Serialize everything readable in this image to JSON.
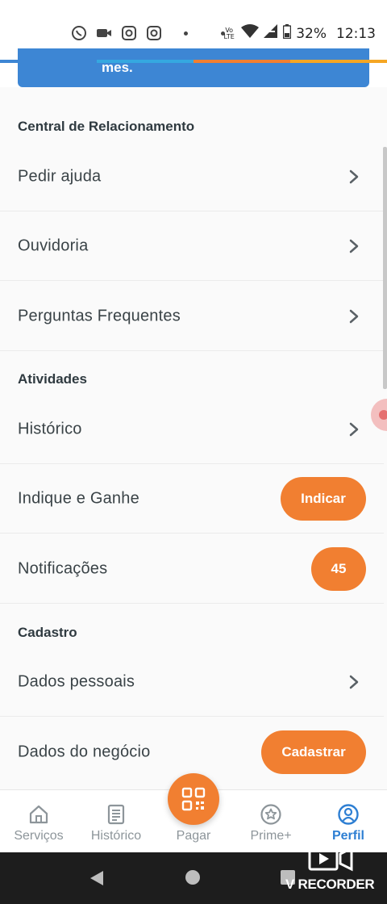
{
  "status_bar": {
    "battery": "32%",
    "time": "12:13",
    "volte_top": "Vo",
    "volte_bottom": "LTE"
  },
  "banner": {
    "text": "mes."
  },
  "sections": {
    "central": "Central de Relacionamento",
    "atividades": "Atividades",
    "cadastro": "Cadastro"
  },
  "rows": {
    "pedir_ajuda": "Pedir ajuda",
    "ouvidoria": "Ouvidoria",
    "perguntas": "Perguntas Frequentes",
    "historico": "Histórico",
    "indique": "Indique e Ganhe",
    "indique_button": "Indicar",
    "notificacoes": "Notificações",
    "notificacoes_count": "45",
    "dados_pessoais": "Dados pessoais",
    "dados_negocio": "Dados do negócio",
    "dados_negocio_button": "Cadastrar"
  },
  "bottom_nav": {
    "servicos": "Serviços",
    "historico": "Histórico",
    "pagar": "Pagar",
    "prime": "Prime+",
    "perfil": "Perfil",
    "active": "perfil"
  },
  "recorder": {
    "label": "V RECORDER"
  },
  "colors": {
    "accent_orange": "#f17f31",
    "accent_blue": "#2e7fd3",
    "banner_blue": "#3d86d4"
  },
  "icons": {
    "status": [
      "whatsapp-icon",
      "video-icon",
      "instagram-icon",
      "instagram-icon",
      "wifi-icon",
      "signal-icon",
      "battery-icon"
    ],
    "rows": "chevron-right-icon",
    "nav": [
      "home-icon",
      "document-icon",
      "qr-code-icon",
      "star-icon",
      "user-icon"
    ]
  }
}
